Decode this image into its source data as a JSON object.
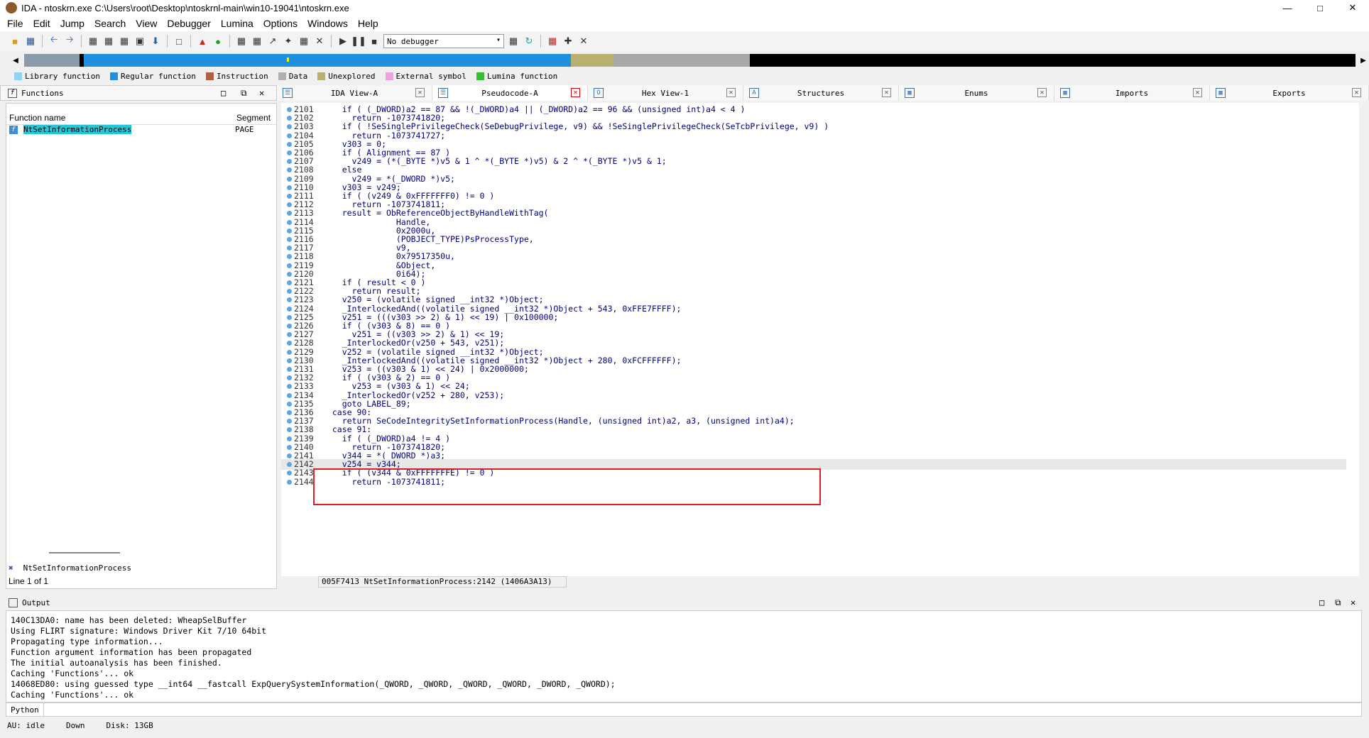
{
  "window": {
    "title": "IDA - ntoskrn.exe C:\\Users\\root\\Desktop\\ntoskrnl-main\\win10-19041\\ntoskrn.exe",
    "min": "—",
    "max": "□",
    "close": "✕"
  },
  "menu": [
    "File",
    "Edit",
    "Jump",
    "Search",
    "View",
    "Debugger",
    "Lumina",
    "Options",
    "Windows",
    "Help"
  ],
  "toolbar": {
    "debugger_select": "No debugger"
  },
  "legend": [
    {
      "label": "Library function",
      "color": "#8fd3f0"
    },
    {
      "label": "Regular function",
      "color": "#1e90e0"
    },
    {
      "label": "Instruction",
      "color": "#b06040"
    },
    {
      "label": "Data",
      "color": "#b0b0b0"
    },
    {
      "label": "Unexplored",
      "color": "#b8b070"
    },
    {
      "label": "External symbol",
      "color": "#f0a0e0"
    },
    {
      "label": "Lumina function",
      "color": "#30c030"
    }
  ],
  "functions_panel": {
    "title": "Functions",
    "col_name": "Function name",
    "col_segment": "Segment",
    "rows": [
      {
        "name": "NtSetInformationProcess",
        "segment": "PAGE"
      }
    ],
    "footer_name": "NtSetInformationProcess",
    "line_info": "Line 1 of 1"
  },
  "tabs": [
    {
      "label": "IDA View-A",
      "icon": "list-icon",
      "active": false
    },
    {
      "label": "Pseudocode-A",
      "icon": "code-icon",
      "active": true
    },
    {
      "label": "Hex View-1",
      "icon": "hex-icon",
      "active": false
    },
    {
      "label": "Structures",
      "icon": "struct-icon",
      "active": false
    },
    {
      "label": "Enums",
      "icon": "enum-icon",
      "active": false
    },
    {
      "label": "Imports",
      "icon": "import-icon",
      "active": false
    },
    {
      "label": "Exports",
      "icon": "export-icon",
      "active": false
    }
  ],
  "code_lines": [
    {
      "n": "2101",
      "t": "    if ( (_DWORD)a2 == 87 && !(_DWORD)a4 || (_DWORD)a2 == 96 && (unsigned int)a4 < 4 )"
    },
    {
      "n": "2102",
      "t": "      return -1073741820;"
    },
    {
      "n": "2103",
      "t": "    if ( !SeSinglePrivilegeCheck(SeDebugPrivilege, v9) && !SeSinglePrivilegeCheck(SeTcbPrivilege, v9) )"
    },
    {
      "n": "2104",
      "t": "      return -1073741727;"
    },
    {
      "n": "2105",
      "t": "    v303 = 0;"
    },
    {
      "n": "2106",
      "t": "    if ( Alignment == 87 )"
    },
    {
      "n": "2107",
      "t": "      v249 = (*(_BYTE *)v5 & 1 ^ *(_BYTE *)v5) & 2 ^ *(_BYTE *)v5 & 1;"
    },
    {
      "n": "2108",
      "t": "    else"
    },
    {
      "n": "2109",
      "t": "      v249 = *(_DWORD *)v5;"
    },
    {
      "n": "2110",
      "t": "    v303 = v249;"
    },
    {
      "n": "2111",
      "t": "    if ( (v249 & 0xFFFFFFF0) != 0 )"
    },
    {
      "n": "2112",
      "t": "      return -1073741811;"
    },
    {
      "n": "2113",
      "t": "    result = ObReferenceObjectByHandleWithTag("
    },
    {
      "n": "2114",
      "t": "               Handle,"
    },
    {
      "n": "2115",
      "t": "               0x2000u,"
    },
    {
      "n": "2116",
      "t": "               (POBJECT_TYPE)PsProcessType,"
    },
    {
      "n": "2117",
      "t": "               v9,"
    },
    {
      "n": "2118",
      "t": "               0x79517350u,"
    },
    {
      "n": "2119",
      "t": "               &Object,"
    },
    {
      "n": "2120",
      "t": "               0i64);"
    },
    {
      "n": "2121",
      "t": "    if ( result < 0 )"
    },
    {
      "n": "2122",
      "t": "      return result;"
    },
    {
      "n": "2123",
      "t": "    v250 = (volatile signed __int32 *)Object;"
    },
    {
      "n": "2124",
      "t": "    _InterlockedAnd((volatile signed __int32 *)Object + 543, 0xFFE7FFFF);"
    },
    {
      "n": "2125",
      "t": "    v251 = (((v303 >> 2) & 1) << 19) | 0x100000;"
    },
    {
      "n": "2126",
      "t": "    if ( (v303 & 8) == 0 )"
    },
    {
      "n": "2127",
      "t": "      v251 = ((v303 >> 2) & 1) << 19;"
    },
    {
      "n": "2128",
      "t": "    _InterlockedOr(v250 + 543, v251);"
    },
    {
      "n": "2129",
      "t": "    v252 = (volatile signed __int32 *)Object;"
    },
    {
      "n": "2130",
      "t": "    _InterlockedAnd((volatile signed __int32 *)Object + 280, 0xFCFFFFFF);"
    },
    {
      "n": "2131",
      "t": "    v253 = ((v303 & 1) << 24) | 0x2000000;"
    },
    {
      "n": "2132",
      "t": "    if ( (v303 & 2) == 0 )"
    },
    {
      "n": "2133",
      "t": "      v253 = (v303 & 1) << 24;"
    },
    {
      "n": "2134",
      "t": "    _InterlockedOr(v252 + 280, v253);"
    },
    {
      "n": "2135",
      "t": "    goto LABEL_89;"
    },
    {
      "n": "2136",
      "t": "  case 90:"
    },
    {
      "n": "2137",
      "t": "    return SeCodeIntegritySetInformationProcess(Handle, (unsigned int)a2, a3, (unsigned int)a4);"
    },
    {
      "n": "2138",
      "t": "  case 91:"
    },
    {
      "n": "2139",
      "t": "    if ( (_DWORD)a4 != 4 )"
    },
    {
      "n": "2140",
      "t": "      return -1073741820;"
    },
    {
      "n": "2141",
      "t": "    v344 = *(_DWORD *)a3;"
    },
    {
      "n": "2142",
      "t": "    v254 = v344;"
    },
    {
      "n": "2143",
      "t": "    if ( (v344 & 0xFFFFFFFE) != 0 )"
    },
    {
      "n": "2144",
      "t": "      return -1073741811;"
    }
  ],
  "current_line": "2142",
  "code_status": "005F7413 NtSetInformationProcess:2142 (1406A3A13)",
  "output": {
    "title": "Output",
    "lines": [
      "140C13DA0: name has been deleted: WheapSelBuffer",
      "Using FLIRT signature: Windows Driver Kit 7/10 64bit",
      "Propagating type information...",
      "Function argument information has been propagated",
      "The initial autoanalysis has been finished.",
      "Caching 'Functions'... ok",
      "14068ED80: using guessed type __int64 __fastcall ExpQuerySystemInformation(_QWORD, _QWORD, _QWORD, _QWORD, _DWORD, _QWORD);",
      "Caching 'Functions'... ok"
    ]
  },
  "python_label": "Python",
  "status": {
    "au": "AU:  idle",
    "dir": "Down",
    "disk": "Disk: 13GB"
  }
}
